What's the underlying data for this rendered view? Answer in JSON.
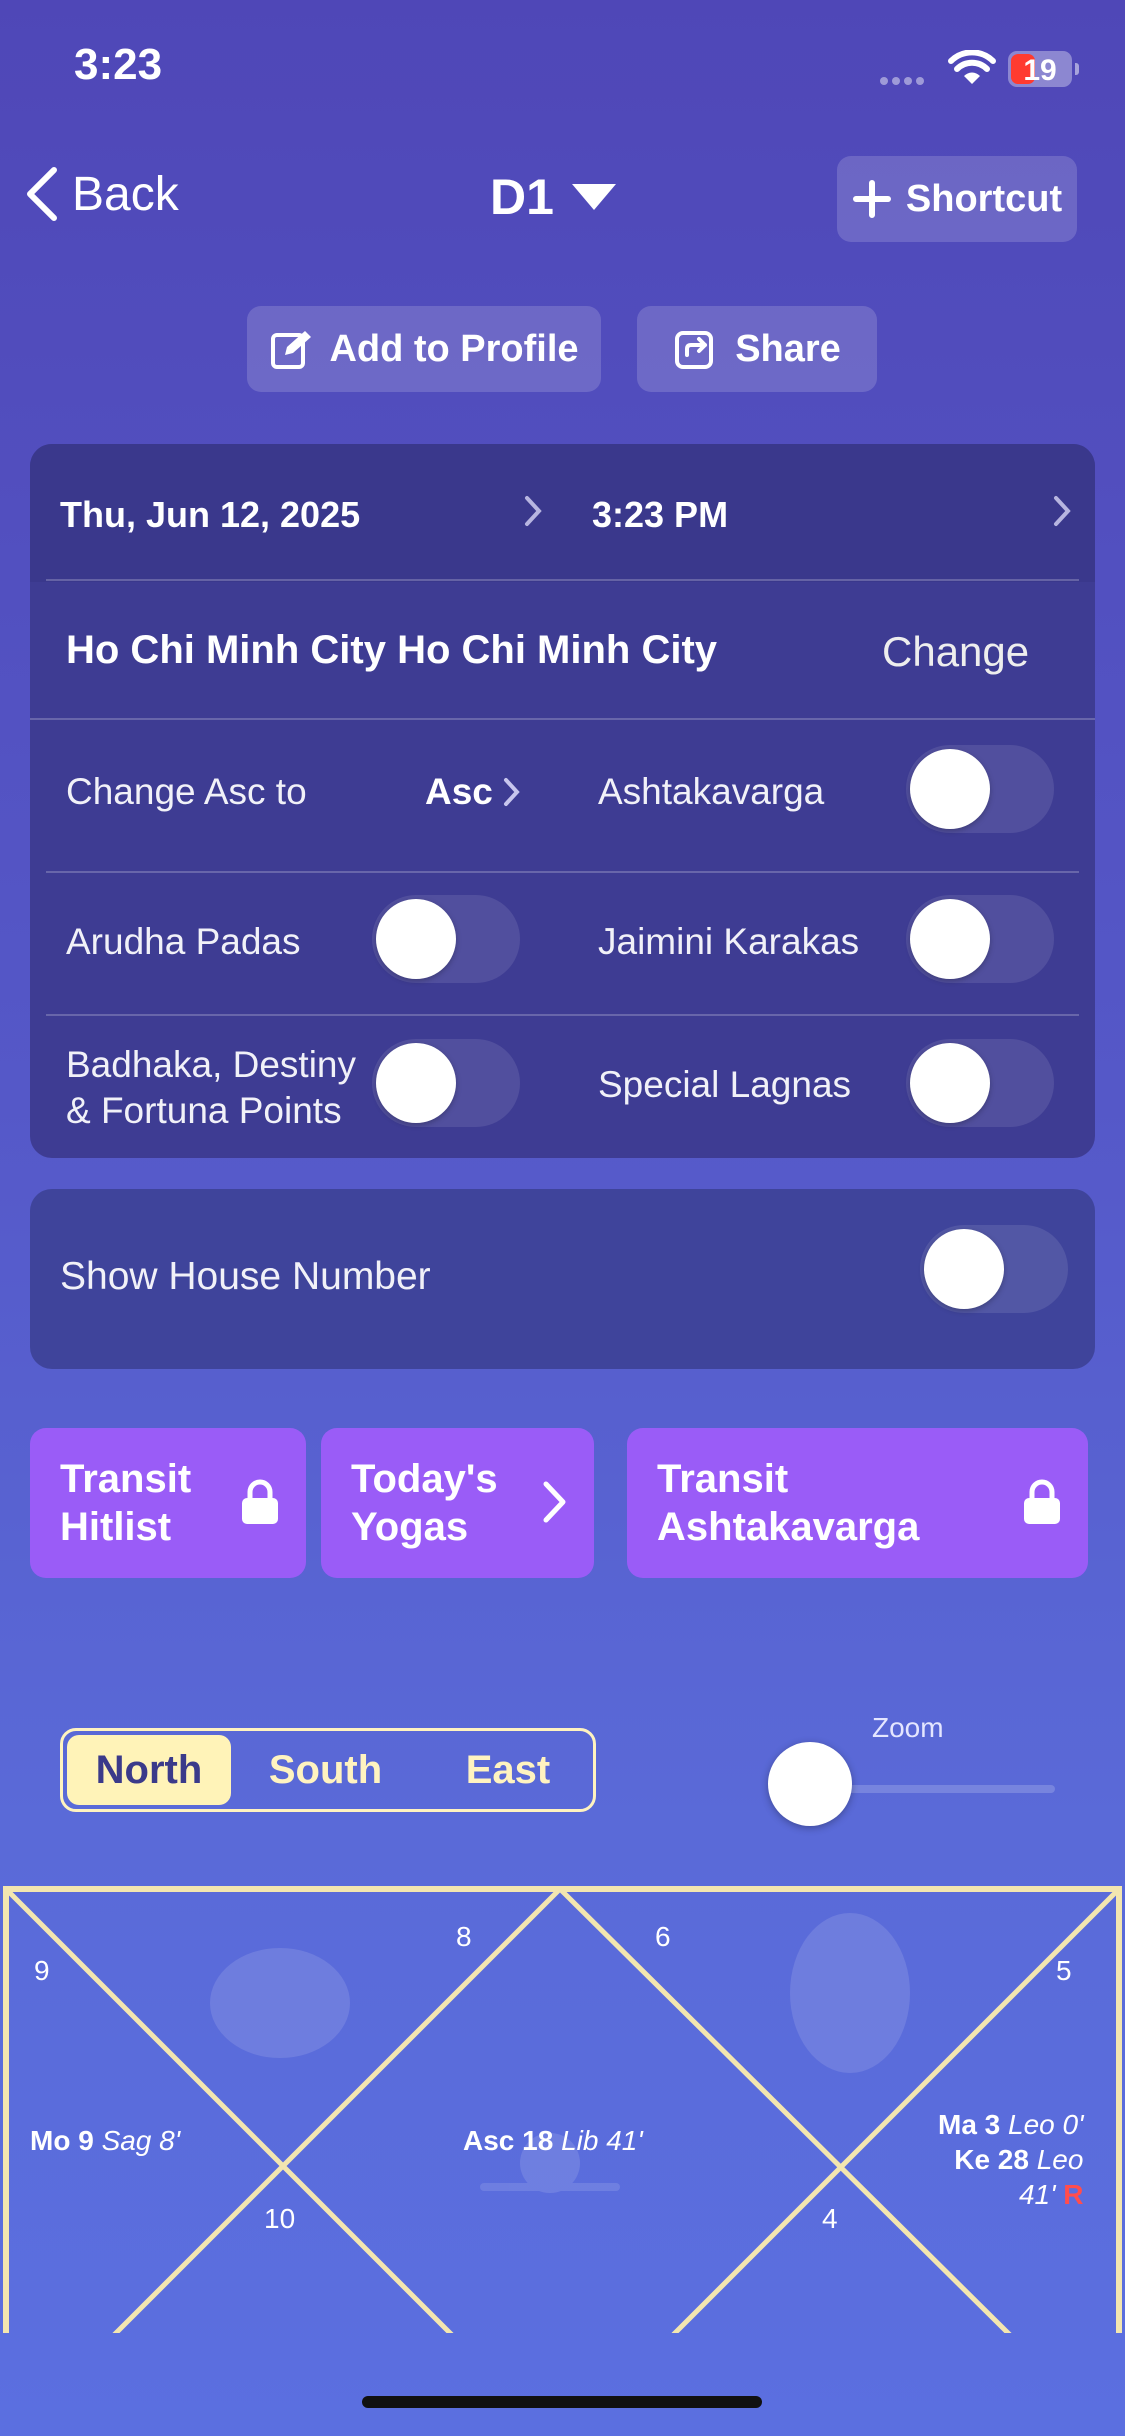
{
  "status_bar": {
    "time": "3:23",
    "battery": "19"
  },
  "nav": {
    "back_label": "Back",
    "title": "D1",
    "shortcut_label": "Shortcut"
  },
  "actions": {
    "add_profile": "Add to Profile",
    "share": "Share"
  },
  "settings": {
    "date": "Thu, Jun 12, 2025",
    "time": "3:23 PM",
    "location": "Ho Chi Minh City Ho Chi Minh City",
    "change": "Change",
    "change_asc_label": "Change Asc to",
    "asc_value": "Asc",
    "ashtakavarga": "Ashtakavarga",
    "arudha_padas": "Arudha Padas",
    "jaimini_karakas": "Jaimini Karakas",
    "badhaka_line1": "Badhaka, Destiny",
    "badhaka_line2": "& Fortuna Points",
    "special_lagnas": "Special Lagnas",
    "show_house_number": "Show House Number",
    "toggles": {
      "ashtakavarga": false,
      "arudha_padas": false,
      "jaimini_karakas": false,
      "badhaka": false,
      "special_lagnas": false,
      "show_house_number": false
    }
  },
  "features": {
    "transit_hitlist_1": "Transit",
    "transit_hitlist_2": "Hitlist",
    "todays_yogas_1": "Today's",
    "todays_yogas_2": "Yogas",
    "transit_ashtakavarga_1": "Transit",
    "transit_ashtakavarga_2": "Ashtakavarga"
  },
  "chart_style": {
    "options": [
      "North",
      "South",
      "East"
    ],
    "selected": "North",
    "zoom_label": "Zoom"
  },
  "chart": {
    "house_numbers": {
      "h9": "9",
      "h8": "8",
      "h6": "6",
      "h5": "5",
      "h10": "10",
      "h4": "4"
    },
    "mo_name": "Mo 9",
    "mo_sign": "Sag 8'",
    "asc_name": "Asc 18",
    "asc_sign": "Lib 41'",
    "ma_name": "Ma 3",
    "ma_sign": "Leo 0'",
    "ke_name": "Ke 28",
    "ke_sign": "Leo",
    "ke_sign2": "41'",
    "ke_retro": "R"
  },
  "colors": {
    "accent_purple": "#9a5cf7",
    "segment_selected": "#fff3b8",
    "chart_line": "#f3e6b0",
    "retro": "#ff4d4d"
  }
}
